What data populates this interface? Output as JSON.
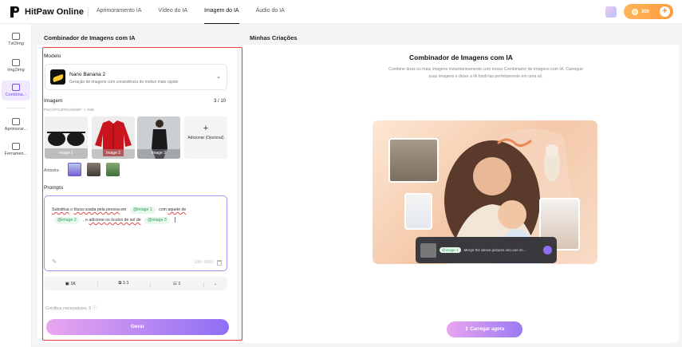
{
  "app": {
    "name": "HitPaw Online"
  },
  "topnav": [
    {
      "label": "Aprimoramento IA",
      "active": false
    },
    {
      "label": "Vídeo do IA",
      "active": false
    },
    {
      "label": "Imagem do IA",
      "active": true
    },
    {
      "label": "Áudio do IA",
      "active": false
    }
  ],
  "header": {
    "credits": "300"
  },
  "sidebar": {
    "items": [
      {
        "label": "Txt2Img",
        "icon": "text-to-image-icon"
      },
      {
        "label": "Img2Img",
        "icon": "image-to-image-icon"
      },
      {
        "label": "Combina...",
        "icon": "combine-icon",
        "active": true
      },
      {
        "label": "Aprimorar...",
        "icon": "enhance-icon"
      },
      {
        "label": "Ferramen...",
        "icon": "tools-icon"
      }
    ]
  },
  "left": {
    "title": "Combinador de Imagens com IA",
    "model_label": "Modelo",
    "model": {
      "name": "Nano Banana 2",
      "description": "Geração de imagens com consistência de motivo mais rápido"
    },
    "image_label": "Imagem",
    "image_count": "3 / 10",
    "image_formats": "PNG/JPG/JPEG/WEBP; < 7MB",
    "images": [
      "Image 1",
      "Image 2",
      "Image 3"
    ],
    "add_label": "Adicionar (Opcional)",
    "sample_label": "Amostra :",
    "prompts_label": "Prompts",
    "prompt": {
      "p1": "Substitua",
      "p2": "o",
      "p3": "blusa usada pela pessoa",
      "p4": "em",
      "tag1": "@image 1",
      "p5": "com",
      "p6": "aquele de",
      "tag2": "@image 2",
      "p7": ", e",
      "p8": "adicione os óculos de sol de",
      "tag3": "@image 3"
    },
    "char_count": "109 / 2000",
    "options": {
      "resolution": "1K",
      "ratio": "1:1",
      "count": "1"
    },
    "credits_needed": "Créditos necessários: 5",
    "generate_label": "Gerar"
  },
  "right": {
    "title": "Minhas Criações",
    "heading": "Combinador de Imagens com IA",
    "description": "Combine duas ou mais imagens instantaneamente com nosso Combinador de Imagens com IA. Carregue suas imagens e deixe a IA fundi-las perfeitamente em uma só.",
    "hero_tag": "@image 1",
    "hero_prompt": "Merge the above pictures into one im...",
    "upload_label": "Carregar agora"
  },
  "colors": {
    "accent": "#8e6ff6",
    "highlight": "#e4423a",
    "orange": "#ff9a3e"
  }
}
